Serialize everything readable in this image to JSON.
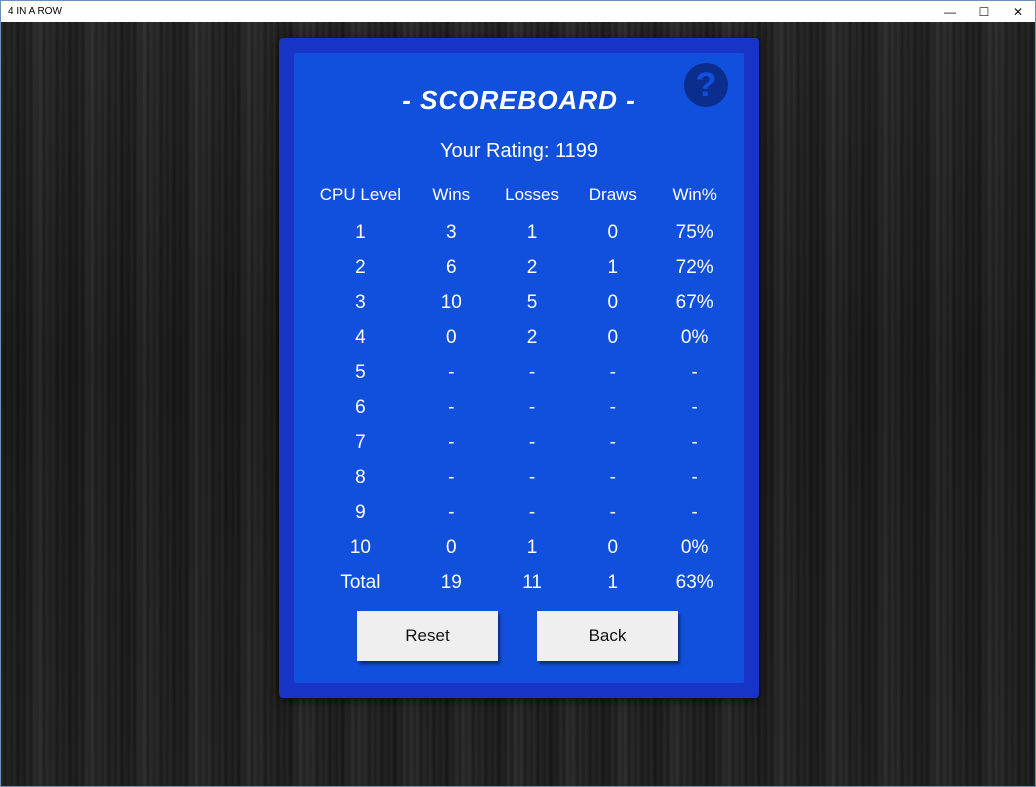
{
  "window": {
    "title": "4 IN A ROW",
    "minimize_glyph": "—",
    "maximize_glyph": "☐",
    "close_glyph": "✕"
  },
  "scoreboard": {
    "title": "- SCOREBOARD -",
    "help_glyph": "?",
    "rating_text": "Your Rating: 1199",
    "columns": [
      "CPU Level",
      "Wins",
      "Losses",
      "Draws",
      "Win%"
    ],
    "rows": [
      [
        "1",
        "3",
        "1",
        "0",
        "75%"
      ],
      [
        "2",
        "6",
        "2",
        "1",
        "72%"
      ],
      [
        "3",
        "10",
        "5",
        "0",
        "67%"
      ],
      [
        "4",
        "0",
        "2",
        "0",
        "0%"
      ],
      [
        "5",
        "-",
        "-",
        "-",
        "-"
      ],
      [
        "6",
        "-",
        "-",
        "-",
        "-"
      ],
      [
        "7",
        "-",
        "-",
        "-",
        "-"
      ],
      [
        "8",
        "-",
        "-",
        "-",
        "-"
      ],
      [
        "9",
        "-",
        "-",
        "-",
        "-"
      ],
      [
        "10",
        "0",
        "1",
        "0",
        "0%"
      ],
      [
        "Total",
        "19",
        "11",
        "1",
        "63%"
      ]
    ]
  },
  "buttons": {
    "reset_label": "Reset",
    "back_label": "Back"
  },
  "colors": {
    "panel_border": "#1734c6",
    "panel_fill": "#1150dc",
    "help_circle": "#0b2e8e",
    "button_fill": "#efefef"
  },
  "icons": {
    "help": "help-icon",
    "minimize": "minimize-icon",
    "maximize": "maximize-icon",
    "close": "close-icon"
  }
}
